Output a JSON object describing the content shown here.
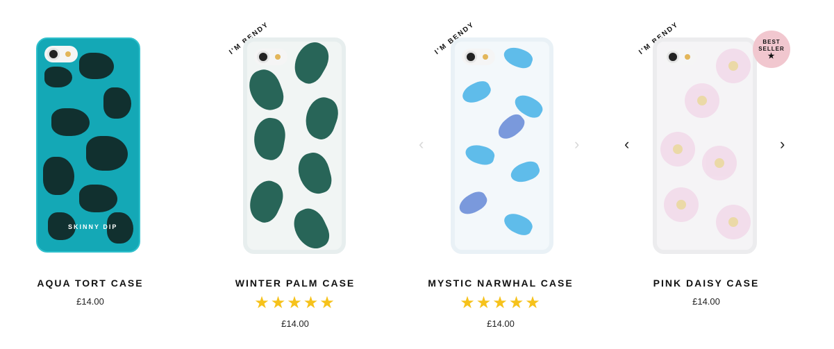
{
  "products": [
    {
      "name": "AQUA TORT CASE",
      "price": "£14.00",
      "brand_mark": "SKINNY DIP"
    },
    {
      "name": "WINTER PALM CASE",
      "price": "£14.00",
      "tag": "I'M BENDY",
      "rating": "★★★★★",
      "rating_value": 5
    },
    {
      "name": "MYSTIC NARWHAL CASE",
      "price": "£14.00",
      "tag": "I'M BENDY",
      "rating": "★★★★★",
      "rating_value": 5
    },
    {
      "name": "PINK DAISY CASE",
      "price": "£14.00",
      "tag": "I'M BENDY",
      "badge_line1": "BEST",
      "badge_line2": "SELLER",
      "badge_star": "★"
    }
  ],
  "carousel": {
    "prev_icon": "‹",
    "next_icon": "›"
  },
  "colors": {
    "rating": "#f6c21b",
    "badge": "#f1c7cf"
  }
}
